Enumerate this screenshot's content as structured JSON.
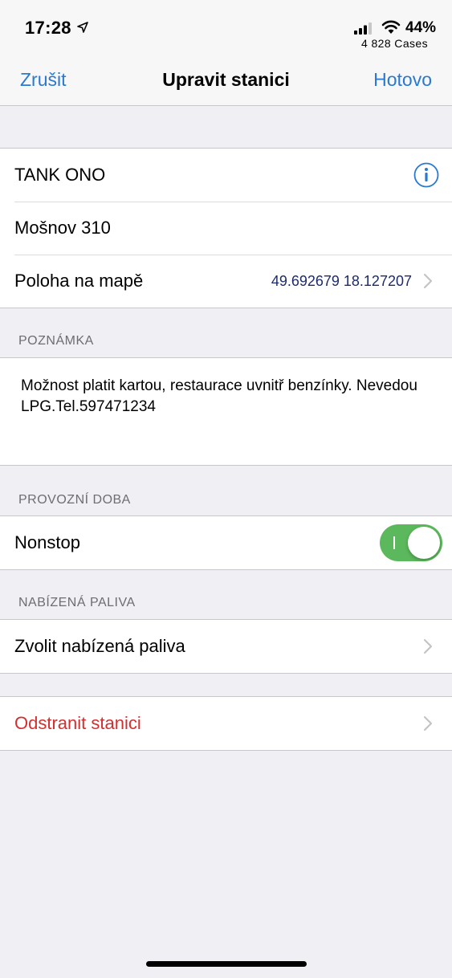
{
  "status_bar": {
    "time": "17:28",
    "battery": "44%",
    "carrier": "4 828 Cases"
  },
  "nav": {
    "cancel": "Zrušit",
    "title": "Upravit stanici",
    "done": "Hotovo"
  },
  "station": {
    "name": "TANK ONO",
    "address": "Mošnov 310",
    "location_label": "Poloha na mapě",
    "location_value": "49.692679 18.127207"
  },
  "note": {
    "header": "POZNÁMKA",
    "text": "Možnost platit kartou, restaurace uvnitř benzínky. Nevedou LPG.Tel.597471234"
  },
  "hours": {
    "header": "PROVOZNÍ DOBA",
    "nonstop_label": "Nonstop",
    "nonstop_on": true
  },
  "fuels": {
    "header": "NABÍZENÁ PALIVA",
    "select_label": "Zvolit nabízená paliva"
  },
  "delete": {
    "label": "Odstranit stanici"
  },
  "colors": {
    "accent": "#2979d3",
    "danger": "#d32f2f",
    "toggle_on": "#5cb85c",
    "background": "#efeff4"
  }
}
